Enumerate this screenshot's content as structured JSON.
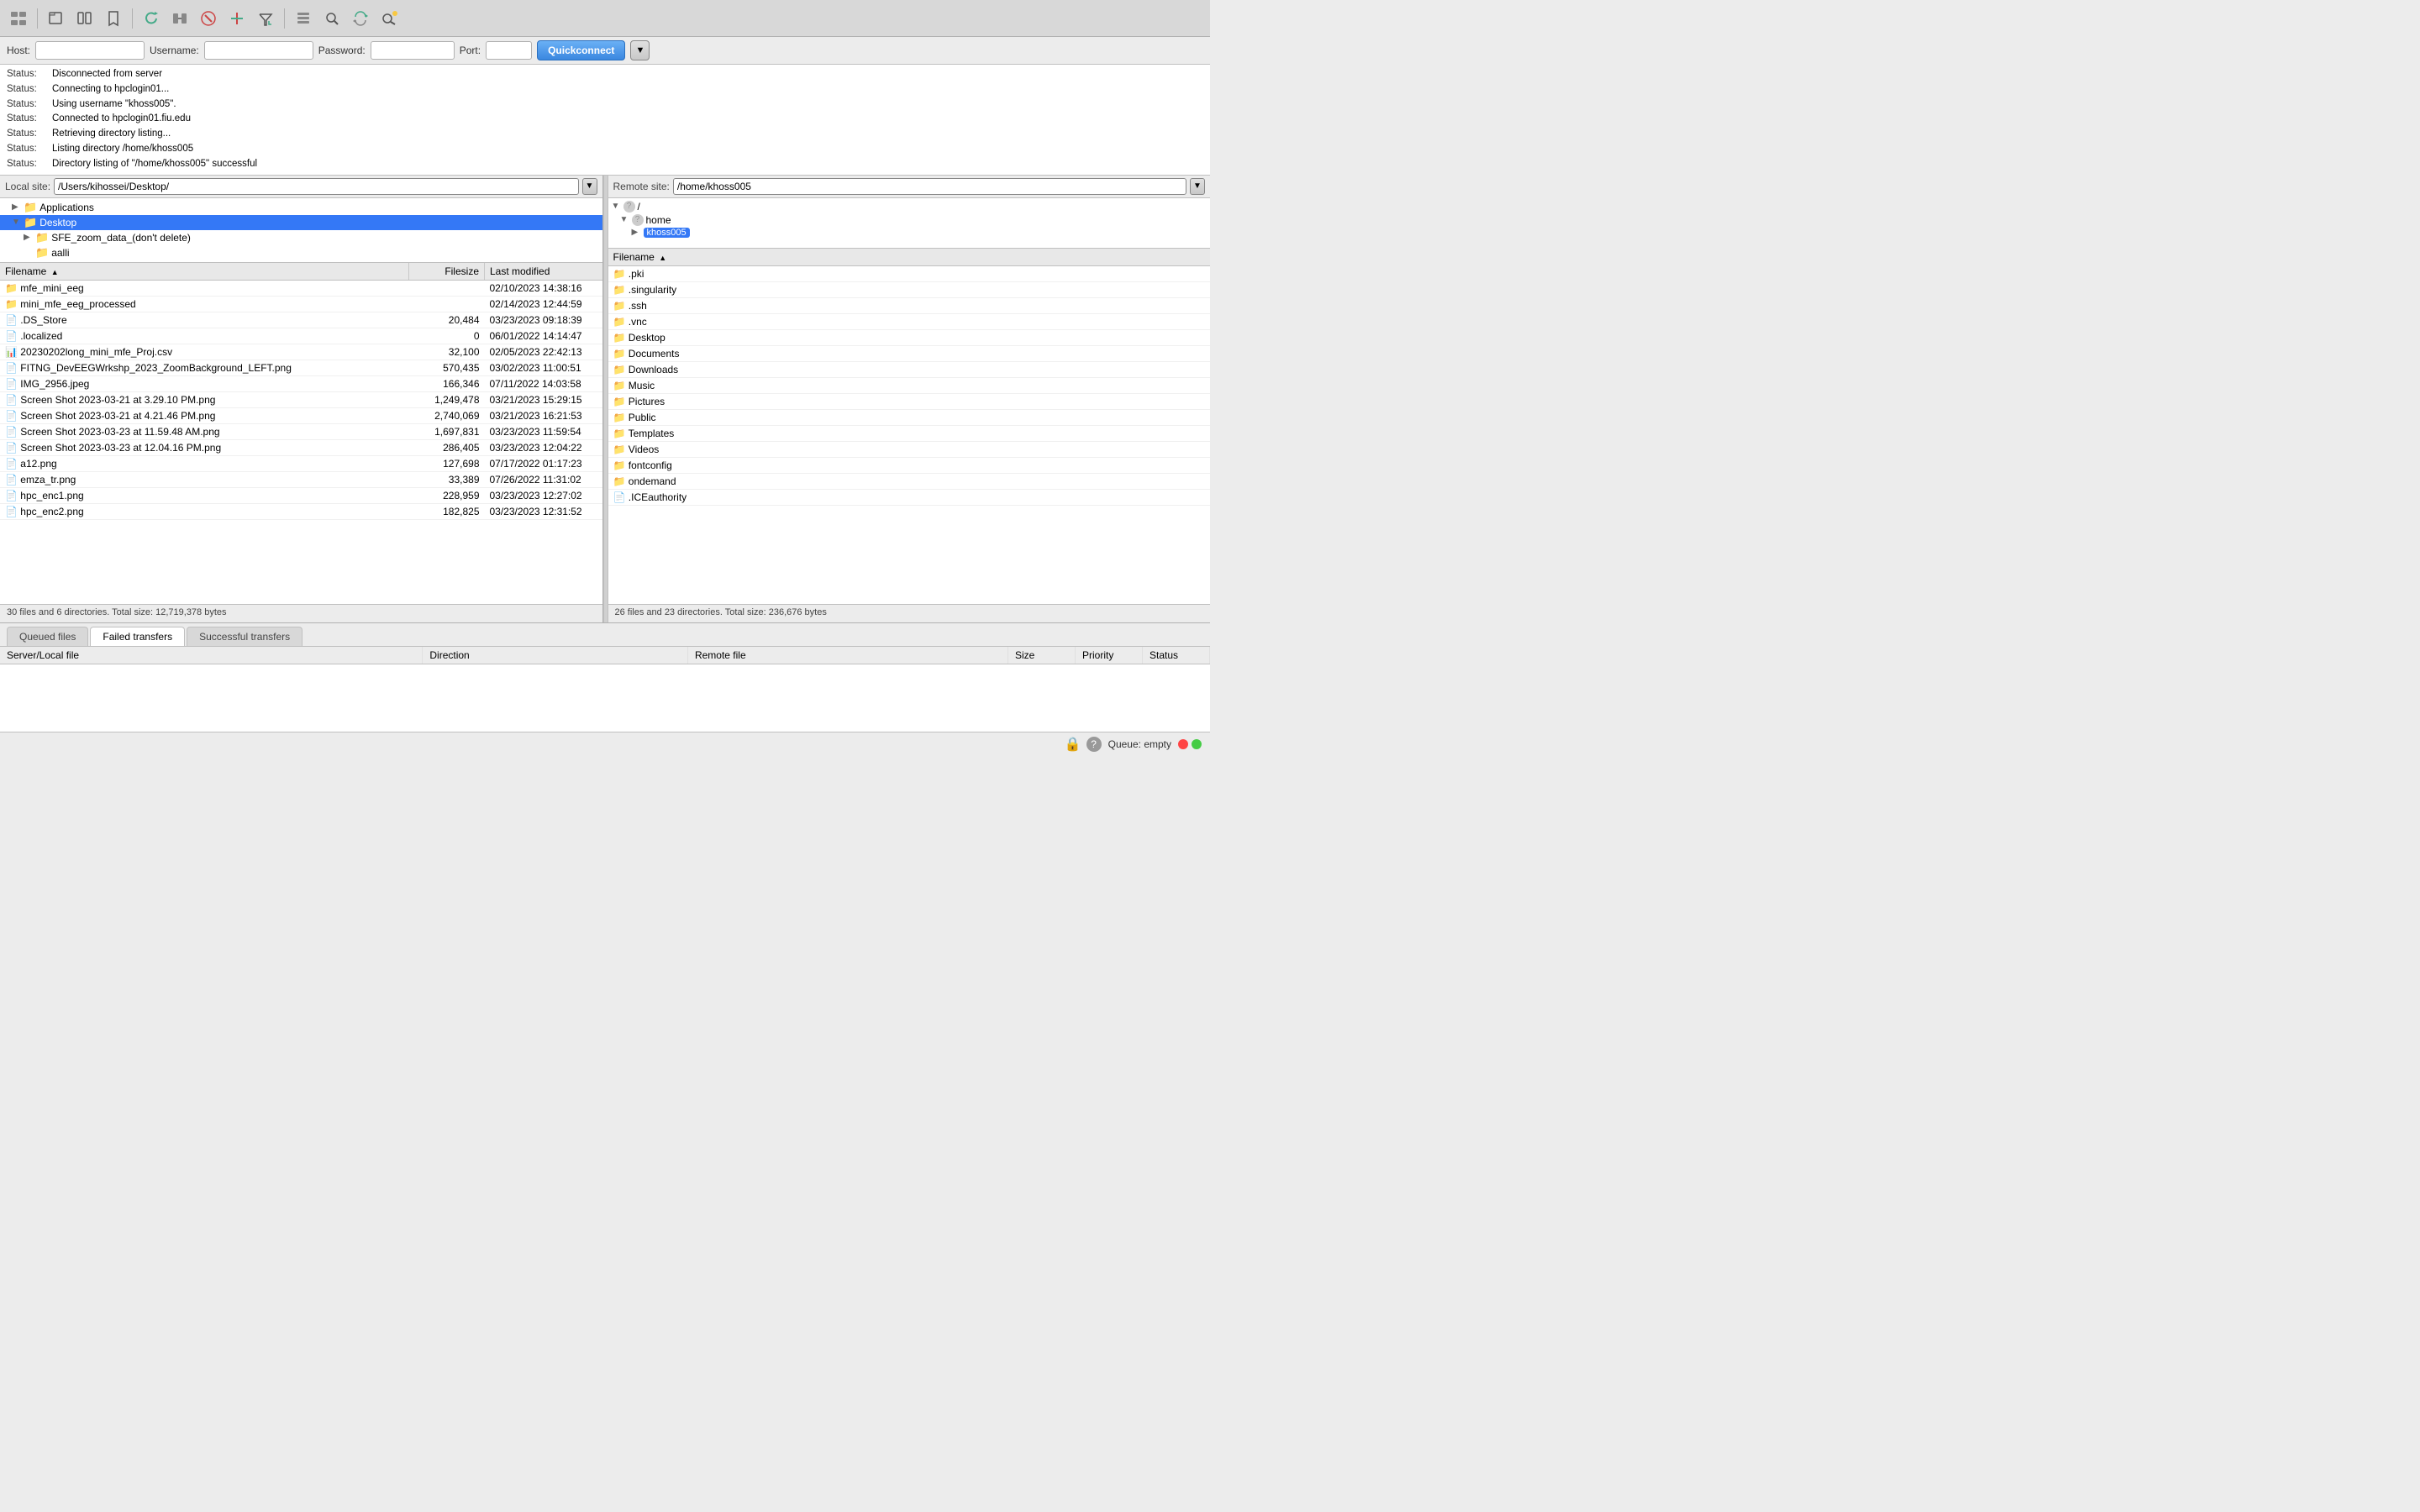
{
  "toolbar": {
    "icons": [
      {
        "name": "site-manager-icon",
        "symbol": "🗂",
        "label": "Site Manager"
      },
      {
        "name": "new-tab-icon",
        "symbol": "📄",
        "label": "New Tab"
      },
      {
        "name": "split-icon",
        "symbol": "⬛",
        "label": "Split View"
      },
      {
        "name": "bookmarks-icon",
        "symbol": "🔖",
        "label": "Bookmarks"
      },
      {
        "name": "refresh-icon",
        "symbol": "🔄",
        "label": "Refresh"
      },
      {
        "name": "directory-comparison-icon",
        "symbol": "⚖",
        "label": "Directory Comparison"
      },
      {
        "name": "cancel-icon",
        "symbol": "⛔",
        "label": "Cancel"
      },
      {
        "name": "delete-icon",
        "symbol": "❌",
        "label": "Delete"
      },
      {
        "name": "checkmark-icon",
        "symbol": "✔",
        "label": "Filter"
      },
      {
        "name": "queue-icon",
        "symbol": "📋",
        "label": "Queue"
      },
      {
        "name": "search-icon",
        "symbol": "🔍",
        "label": "Search"
      },
      {
        "name": "sync-icon",
        "symbol": "🔃",
        "label": "Synchronized Browsing"
      },
      {
        "name": "find-icon",
        "symbol": "🔭",
        "label": "Find Files"
      }
    ]
  },
  "connection": {
    "host_label": "Host:",
    "host_value": "",
    "username_label": "Username:",
    "username_value": "",
    "password_label": "Password:",
    "password_value": "",
    "port_label": "Port:",
    "port_value": "",
    "quickconnect_label": "Quickconnect"
  },
  "status_lines": [
    {
      "key": "Status:",
      "value": "Disconnected from server"
    },
    {
      "key": "Status:",
      "value": "Connecting to hpclogin01..."
    },
    {
      "key": "Status:",
      "value": "Using username \"khoss005\"."
    },
    {
      "key": "Status:",
      "value": "Connected to hpclogin01.fiu.edu"
    },
    {
      "key": "Status:",
      "value": "Retrieving directory listing..."
    },
    {
      "key": "Status:",
      "value": "Listing directory /home/khoss005"
    },
    {
      "key": "Status:",
      "value": "Directory listing of \"/home/khoss005\" successful"
    }
  ],
  "local": {
    "site_label": "Local site:",
    "path": "/Users/kihossei/Desktop/",
    "tree": [
      {
        "label": "Applications",
        "indent": 1,
        "expanded": false,
        "type": "folder"
      },
      {
        "label": "Desktop",
        "indent": 1,
        "expanded": true,
        "type": "folder",
        "selected": true
      },
      {
        "label": "SFE_zoom_data_(don't delete)",
        "indent": 2,
        "expanded": false,
        "type": "folder"
      },
      {
        "label": "aalli",
        "indent": 2,
        "expanded": false,
        "type": "folder"
      }
    ],
    "columns": [
      {
        "key": "filename",
        "label": "Filename",
        "sort": "asc"
      },
      {
        "key": "filesize",
        "label": "Filesize"
      },
      {
        "key": "modified",
        "label": "Last modified"
      }
    ],
    "files": [
      {
        "icon": "folder",
        "name": "mfe_mini_eeg",
        "size": "",
        "modified": "02/10/2023 14:38:16"
      },
      {
        "icon": "folder",
        "name": "mini_mfe_eeg_processed",
        "size": "",
        "modified": "02/14/2023 12:44:59"
      },
      {
        "icon": "hidden",
        "name": ".DS_Store",
        "size": "20,484",
        "modified": "03/23/2023 09:18:39"
      },
      {
        "icon": "hidden",
        "name": ".localized",
        "size": "0",
        "modified": "06/01/2022 14:14:47"
      },
      {
        "icon": "special",
        "name": "20230202long_mini_mfe_Proj.csv",
        "size": "32,100",
        "modified": "02/05/2023 22:42:13"
      },
      {
        "icon": "file",
        "name": "FITNG_DevEEGWrkshp_2023_ZoomBackground_LEFT.png",
        "size": "570,435",
        "modified": "03/02/2023 11:00:51"
      },
      {
        "icon": "file",
        "name": "IMG_2956.jpeg",
        "size": "166,346",
        "modified": "07/11/2022 14:03:58"
      },
      {
        "icon": "file",
        "name": "Screen Shot 2023-03-21 at 3.29.10 PM.png",
        "size": "1,249,478",
        "modified": "03/21/2023 15:29:15"
      },
      {
        "icon": "file",
        "name": "Screen Shot 2023-03-21 at 4.21.46 PM.png",
        "size": "2,740,069",
        "modified": "03/21/2023 16:21:53"
      },
      {
        "icon": "file",
        "name": "Screen Shot 2023-03-23 at 11.59.48 AM.png",
        "size": "1,697,831",
        "modified": "03/23/2023 11:59:54"
      },
      {
        "icon": "file",
        "name": "Screen Shot 2023-03-23 at 12.04.16 PM.png",
        "size": "286,405",
        "modified": "03/23/2023 12:04:22"
      },
      {
        "icon": "file",
        "name": "a12.png",
        "size": "127,698",
        "modified": "07/17/2022 01:17:23"
      },
      {
        "icon": "file",
        "name": "emza_tr.png",
        "size": "33,389",
        "modified": "07/26/2022 11:31:02"
      },
      {
        "icon": "file",
        "name": "hpc_enc1.png",
        "size": "228,959",
        "modified": "03/23/2023 12:27:02"
      },
      {
        "icon": "file",
        "name": "hpc_enc2.png",
        "size": "182,825",
        "modified": "03/23/2023 12:31:52"
      }
    ],
    "footer": "30 files and 6 directories. Total size: 12,719,378 bytes"
  },
  "remote": {
    "site_label": "Remote site:",
    "path": "/home/khoss005",
    "tree": [
      {
        "label": "/",
        "indent": 0,
        "expanded": true,
        "type": "root"
      },
      {
        "label": "home",
        "indent": 1,
        "expanded": true,
        "type": "folder"
      },
      {
        "label": "khoss005",
        "indent": 2,
        "expanded": false,
        "type": "folder",
        "selected": true
      }
    ],
    "columns": [
      {
        "key": "filename",
        "label": "Filename",
        "sort": "asc"
      }
    ],
    "files": [
      {
        "icon": "folder",
        "name": ".pki"
      },
      {
        "icon": "folder",
        "name": ".singularity"
      },
      {
        "icon": "folder",
        "name": ".ssh"
      },
      {
        "icon": "folder",
        "name": ".vnc"
      },
      {
        "icon": "folder",
        "name": "Desktop"
      },
      {
        "icon": "folder",
        "name": "Documents"
      },
      {
        "icon": "folder",
        "name": "Downloads"
      },
      {
        "icon": "folder",
        "name": "Music"
      },
      {
        "icon": "folder",
        "name": "Pictures"
      },
      {
        "icon": "folder",
        "name": "Public"
      },
      {
        "icon": "folder",
        "name": "Templates"
      },
      {
        "icon": "folder",
        "name": "Videos"
      },
      {
        "icon": "folder",
        "name": "fontconfig"
      },
      {
        "icon": "folder",
        "name": "ondemand"
      },
      {
        "icon": "hidden",
        "name": ".ICEauthority"
      }
    ],
    "footer": "26 files and 23 directories. Total size: 236,676 bytes"
  },
  "transfer": {
    "tabs": [
      {
        "label": "Queued files",
        "active": false
      },
      {
        "label": "Failed transfers",
        "active": true
      },
      {
        "label": "Successful transfers",
        "active": false
      }
    ],
    "columns": [
      {
        "label": "Server/Local file"
      },
      {
        "label": "Direction"
      },
      {
        "label": "Remote file"
      },
      {
        "label": "Size"
      },
      {
        "label": "Priority"
      },
      {
        "label": "Status"
      }
    ]
  },
  "statusbar": {
    "queue_label": "Queue: empty",
    "lock_icon": "🔒",
    "help_icon": "?"
  }
}
